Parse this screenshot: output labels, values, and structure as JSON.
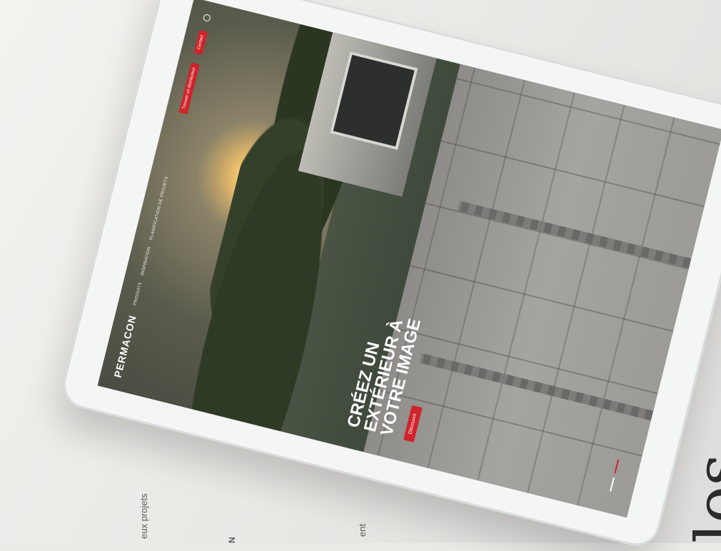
{
  "background_text": {
    "left_caption": "eux projets",
    "middle_caption": "N",
    "right_caption": "ent",
    "large_word": "les"
  },
  "website": {
    "brand": "PERMACON",
    "nav": {
      "links": [
        "Produits",
        "Inspiration",
        "Planification de projets"
      ],
      "buttons": [
        "Trouver un distributeur",
        "Contact"
      ]
    },
    "hero": {
      "title": "CRÉEZ UN EXTÉRIEUR À VOTRE IMAGE",
      "cta_label": "Découvrir"
    },
    "slider": {
      "slides": 2,
      "active": 2
    }
  },
  "colors": {
    "brand_red": "#d0232a",
    "bezel": "#f4f5f5",
    "desk": "#ecebe8"
  },
  "icons": [
    "search-icon"
  ]
}
